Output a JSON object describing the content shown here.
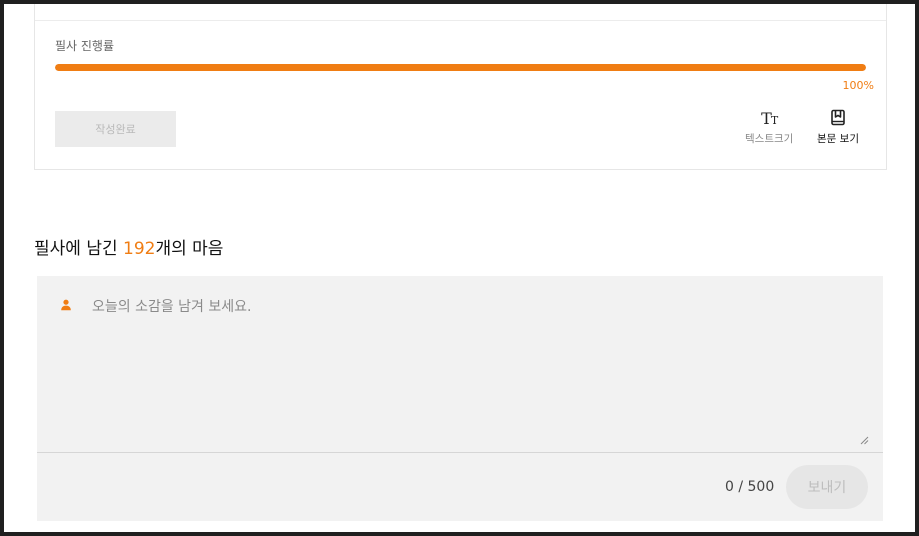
{
  "progress": {
    "label": "필사 진행률",
    "value_percent": 100,
    "percent_text": "100%",
    "color": "#f07d13"
  },
  "actions": {
    "complete_label": "작성완료"
  },
  "tools": {
    "text_size": {
      "glyph": "TT",
      "label": "텍스트크기",
      "icon": "text-size-icon"
    },
    "view_body": {
      "label": "본문 보기",
      "icon": "book-icon"
    }
  },
  "comments": {
    "title_prefix": "필사에 남긴 ",
    "count": "192",
    "title_suffix": "개의 마음",
    "accent_color": "#f07d13",
    "placeholder": "오늘의 소감을 남겨 보세요.",
    "counter": "0 / 500",
    "send_label": "보내기",
    "avatar_icon": "user-icon"
  }
}
